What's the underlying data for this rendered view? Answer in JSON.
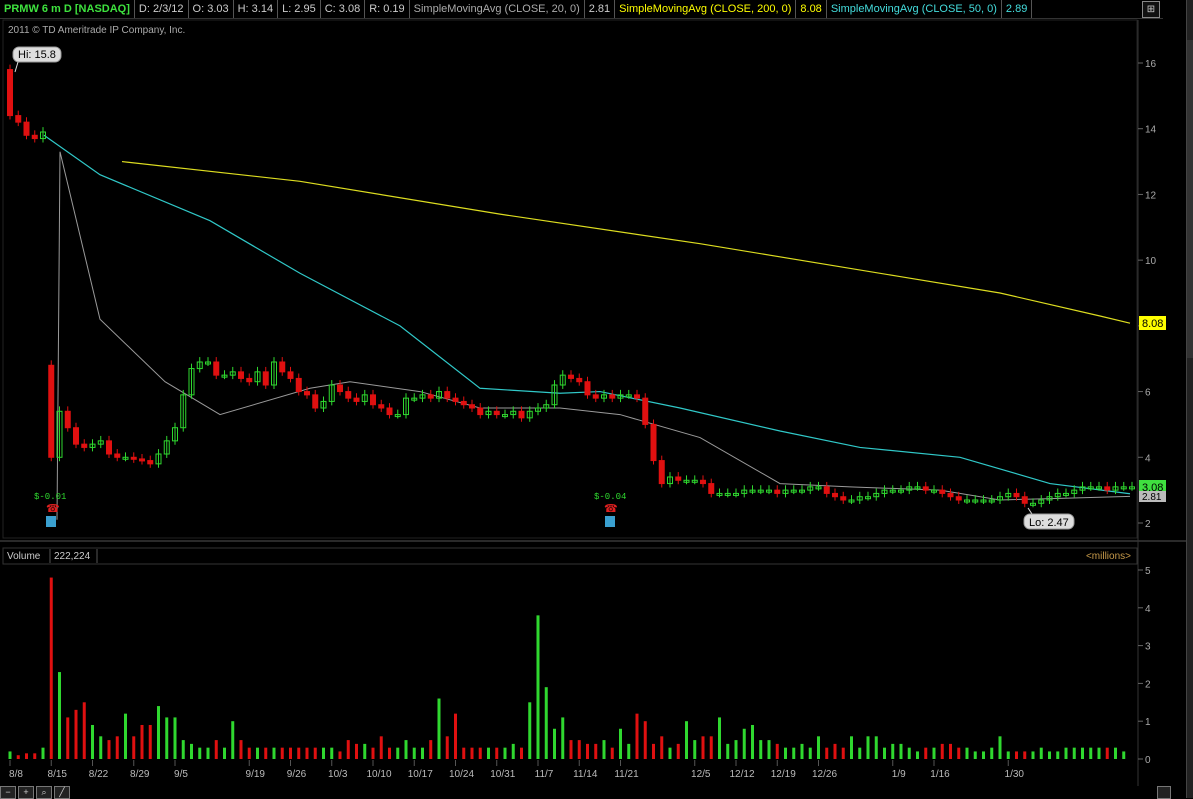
{
  "header": {
    "symbol": "PRMW 6 m D [NASDAQ]",
    "date": "D: 2/3/12",
    "open": "O: 3.03",
    "high": "H: 3.14",
    "low": "L: 2.95",
    "close": "C: 3.08",
    "range": "R: 0.19",
    "sma20_label": "SimpleMovingAvg (CLOSE, 20, 0)",
    "sma20_value": "2.81",
    "sma200_label": "SimpleMovingAvg (CLOSE, 200, 0)",
    "sma200_value": "8.08",
    "sma50_label": "SimpleMovingAvg (CLOSE, 50, 0)",
    "sma50_value": "2.89"
  },
  "copyright": "2011 © TD Ameritrade IP Company, Inc.",
  "hi_label": "Hi: 15.8",
  "lo_label": "Lo: 2.47",
  "earnings": [
    "$-0.01",
    "$-0.04"
  ],
  "volume_panel": {
    "label": "Volume",
    "value": "222,224",
    "units": "<millions>"
  },
  "price_tags": {
    "sma200": "8.08",
    "close": "3.08",
    "sma20": "2.81"
  },
  "colors": {
    "up": "#2fd82f",
    "down": "#e01010",
    "sma20": "#9a9a9a",
    "sma50": "#30c8c8",
    "sma200": "#dddd20"
  },
  "chart_data": {
    "type": "candlestick",
    "price_axis": {
      "ticks": [
        2,
        4,
        6,
        8,
        10,
        12,
        14,
        16
      ],
      "ylim": [
        1.5,
        17
      ]
    },
    "volume_axis": {
      "ticks": [
        0,
        1,
        2,
        3,
        4,
        5
      ],
      "ylim": [
        0,
        5.3
      ]
    },
    "x_ticks": [
      {
        "label": "8/8",
        "i": 0
      },
      {
        "label": "8/15",
        "i": 5
      },
      {
        "label": "8/22",
        "i": 10
      },
      {
        "label": "8/29",
        "i": 15
      },
      {
        "label": "9/5",
        "i": 20
      },
      {
        "label": "9/19",
        "i": 29
      },
      {
        "label": "9/26",
        "i": 34
      },
      {
        "label": "10/3",
        "i": 39
      },
      {
        "label": "10/10",
        "i": 44
      },
      {
        "label": "10/17",
        "i": 49
      },
      {
        "label": "10/24",
        "i": 54
      },
      {
        "label": "10/31",
        "i": 59
      },
      {
        "label": "11/7",
        "i": 64
      },
      {
        "label": "11/14",
        "i": 69
      },
      {
        "label": "11/21",
        "i": 74
      },
      {
        "label": "12/5",
        "i": 83
      },
      {
        "label": "12/12",
        "i": 88
      },
      {
        "label": "12/19",
        "i": 93
      },
      {
        "label": "12/26",
        "i": 98
      },
      {
        "label": "1/9",
        "i": 107
      },
      {
        "label": "1/16",
        "i": 112
      },
      {
        "label": "1/30",
        "i": 121
      }
    ],
    "closes": [
      14.4,
      14.2,
      13.8,
      13.7,
      13.9,
      4.0,
      5.4,
      4.9,
      4.4,
      4.3,
      4.4,
      4.5,
      4.1,
      4.0,
      4.0,
      3.95,
      3.9,
      3.8,
      4.1,
      4.5,
      4.9,
      5.9,
      6.7,
      6.9,
      6.9,
      6.5,
      6.5,
      6.6,
      6.4,
      6.3,
      6.6,
      6.2,
      6.9,
      6.6,
      6.4,
      6.0,
      5.9,
      5.5,
      5.7,
      6.2,
      6.0,
      5.8,
      5.7,
      5.9,
      5.6,
      5.5,
      5.3,
      5.3,
      5.8,
      5.8,
      5.9,
      5.8,
      6.0,
      5.8,
      5.7,
      5.6,
      5.5,
      5.3,
      5.4,
      5.3,
      5.3,
      5.4,
      5.2,
      5.4,
      5.5,
      5.6,
      6.2,
      6.5,
      6.4,
      6.3,
      5.9,
      5.8,
      5.9,
      5.8,
      5.9,
      5.9,
      5.8,
      5.0,
      3.9,
      3.2,
      3.4,
      3.3,
      3.3,
      3.3,
      3.2,
      2.9,
      2.9,
      2.9,
      2.9,
      3.0,
      3.0,
      3.0,
      3.0,
      2.9,
      3.0,
      3.0,
      3.0,
      3.1,
      3.1,
      2.9,
      2.8,
      2.7,
      2.7,
      2.8,
      2.8,
      2.9,
      3.0,
      3.0,
      3.0,
      3.1,
      3.1,
      3.0,
      3.0,
      2.9,
      2.8,
      2.7,
      2.7,
      2.7,
      2.7,
      2.7,
      2.8,
      2.9,
      2.8,
      2.6,
      2.6,
      2.7,
      2.8,
      2.9,
      2.9,
      3.0,
      3.1,
      3.1,
      3.1,
      3.0,
      3.1,
      3.1,
      3.1
    ],
    "sma20_series": [
      [
        57,
        2.1
      ],
      [
        60,
        13.3
      ],
      [
        100,
        8.2
      ],
      [
        165,
        6.3
      ],
      [
        220,
        5.3
      ],
      [
        310,
        6.1
      ],
      [
        350,
        6.3
      ],
      [
        420,
        6.0
      ],
      [
        480,
        5.5
      ],
      [
        560,
        5.5
      ],
      [
        620,
        5.3
      ],
      [
        700,
        4.6
      ],
      [
        780,
        3.2
      ],
      [
        850,
        3.1
      ],
      [
        940,
        3.0
      ],
      [
        1000,
        2.7
      ],
      [
        1060,
        2.75
      ],
      [
        1130,
        2.81
      ]
    ],
    "sma50_series": [
      [
        44,
        13.8
      ],
      [
        100,
        12.6
      ],
      [
        210,
        11.2
      ],
      [
        300,
        9.6
      ],
      [
        400,
        8.0
      ],
      [
        480,
        6.1
      ],
      [
        560,
        5.95
      ],
      [
        600,
        6.0
      ],
      [
        680,
        5.5
      ],
      [
        780,
        4.8
      ],
      [
        860,
        4.3
      ],
      [
        960,
        4.0
      ],
      [
        1050,
        3.2
      ],
      [
        1130,
        2.89
      ]
    ],
    "sma200_series": [
      [
        122,
        13.0
      ],
      [
        300,
        12.4
      ],
      [
        500,
        11.4
      ],
      [
        700,
        10.5
      ],
      [
        900,
        9.5
      ],
      [
        1000,
        9.0
      ],
      [
        1100,
        8.3
      ],
      [
        1130,
        8.08
      ]
    ],
    "volumes": [
      0.2,
      0.1,
      0.15,
      0.15,
      0.3,
      4.8,
      2.3,
      1.1,
      1.3,
      1.5,
      0.9,
      0.6,
      0.5,
      0.6,
      1.2,
      0.6,
      0.9,
      0.9,
      1.4,
      1.1,
      1.1,
      0.5,
      0.4,
      0.3,
      0.3,
      0.5,
      0.3,
      1.0,
      0.5,
      0.3,
      0.3,
      0.3,
      0.3,
      0.3,
      0.3,
      0.3,
      0.3,
      0.3,
      0.3,
      0.3,
      0.2,
      0.5,
      0.4,
      0.4,
      0.3,
      0.6,
      0.3,
      0.3,
      0.5,
      0.3,
      0.3,
      0.5,
      1.6,
      0.6,
      1.2,
      0.3,
      0.3,
      0.3,
      0.3,
      0.3,
      0.3,
      0.4,
      0.3,
      1.5,
      3.8,
      1.9,
      0.8,
      1.1,
      0.5,
      0.5,
      0.4,
      0.4,
      0.5,
      0.3,
      0.8,
      0.4,
      1.2,
      1.0,
      0.4,
      0.6,
      0.3,
      0.4,
      1.0,
      0.5,
      0.6,
      0.6,
      1.1,
      0.4,
      0.5,
      0.8,
      0.9,
      0.5,
      0.5,
      0.4,
      0.3,
      0.3,
      0.4,
      0.3,
      0.6,
      0.3,
      0.4,
      0.3,
      0.6,
      0.3,
      0.6,
      0.6,
      0.3,
      0.4,
      0.4,
      0.3,
      0.2,
      0.3,
      0.3,
      0.4,
      0.4,
      0.3,
      0.3,
      0.2,
      0.2,
      0.3,
      0.6,
      0.2,
      0.2,
      0.2,
      0.2,
      0.3,
      0.2,
      0.2,
      0.3,
      0.3,
      0.3,
      0.3,
      0.3,
      0.3,
      0.3,
      0.2
    ]
  }
}
